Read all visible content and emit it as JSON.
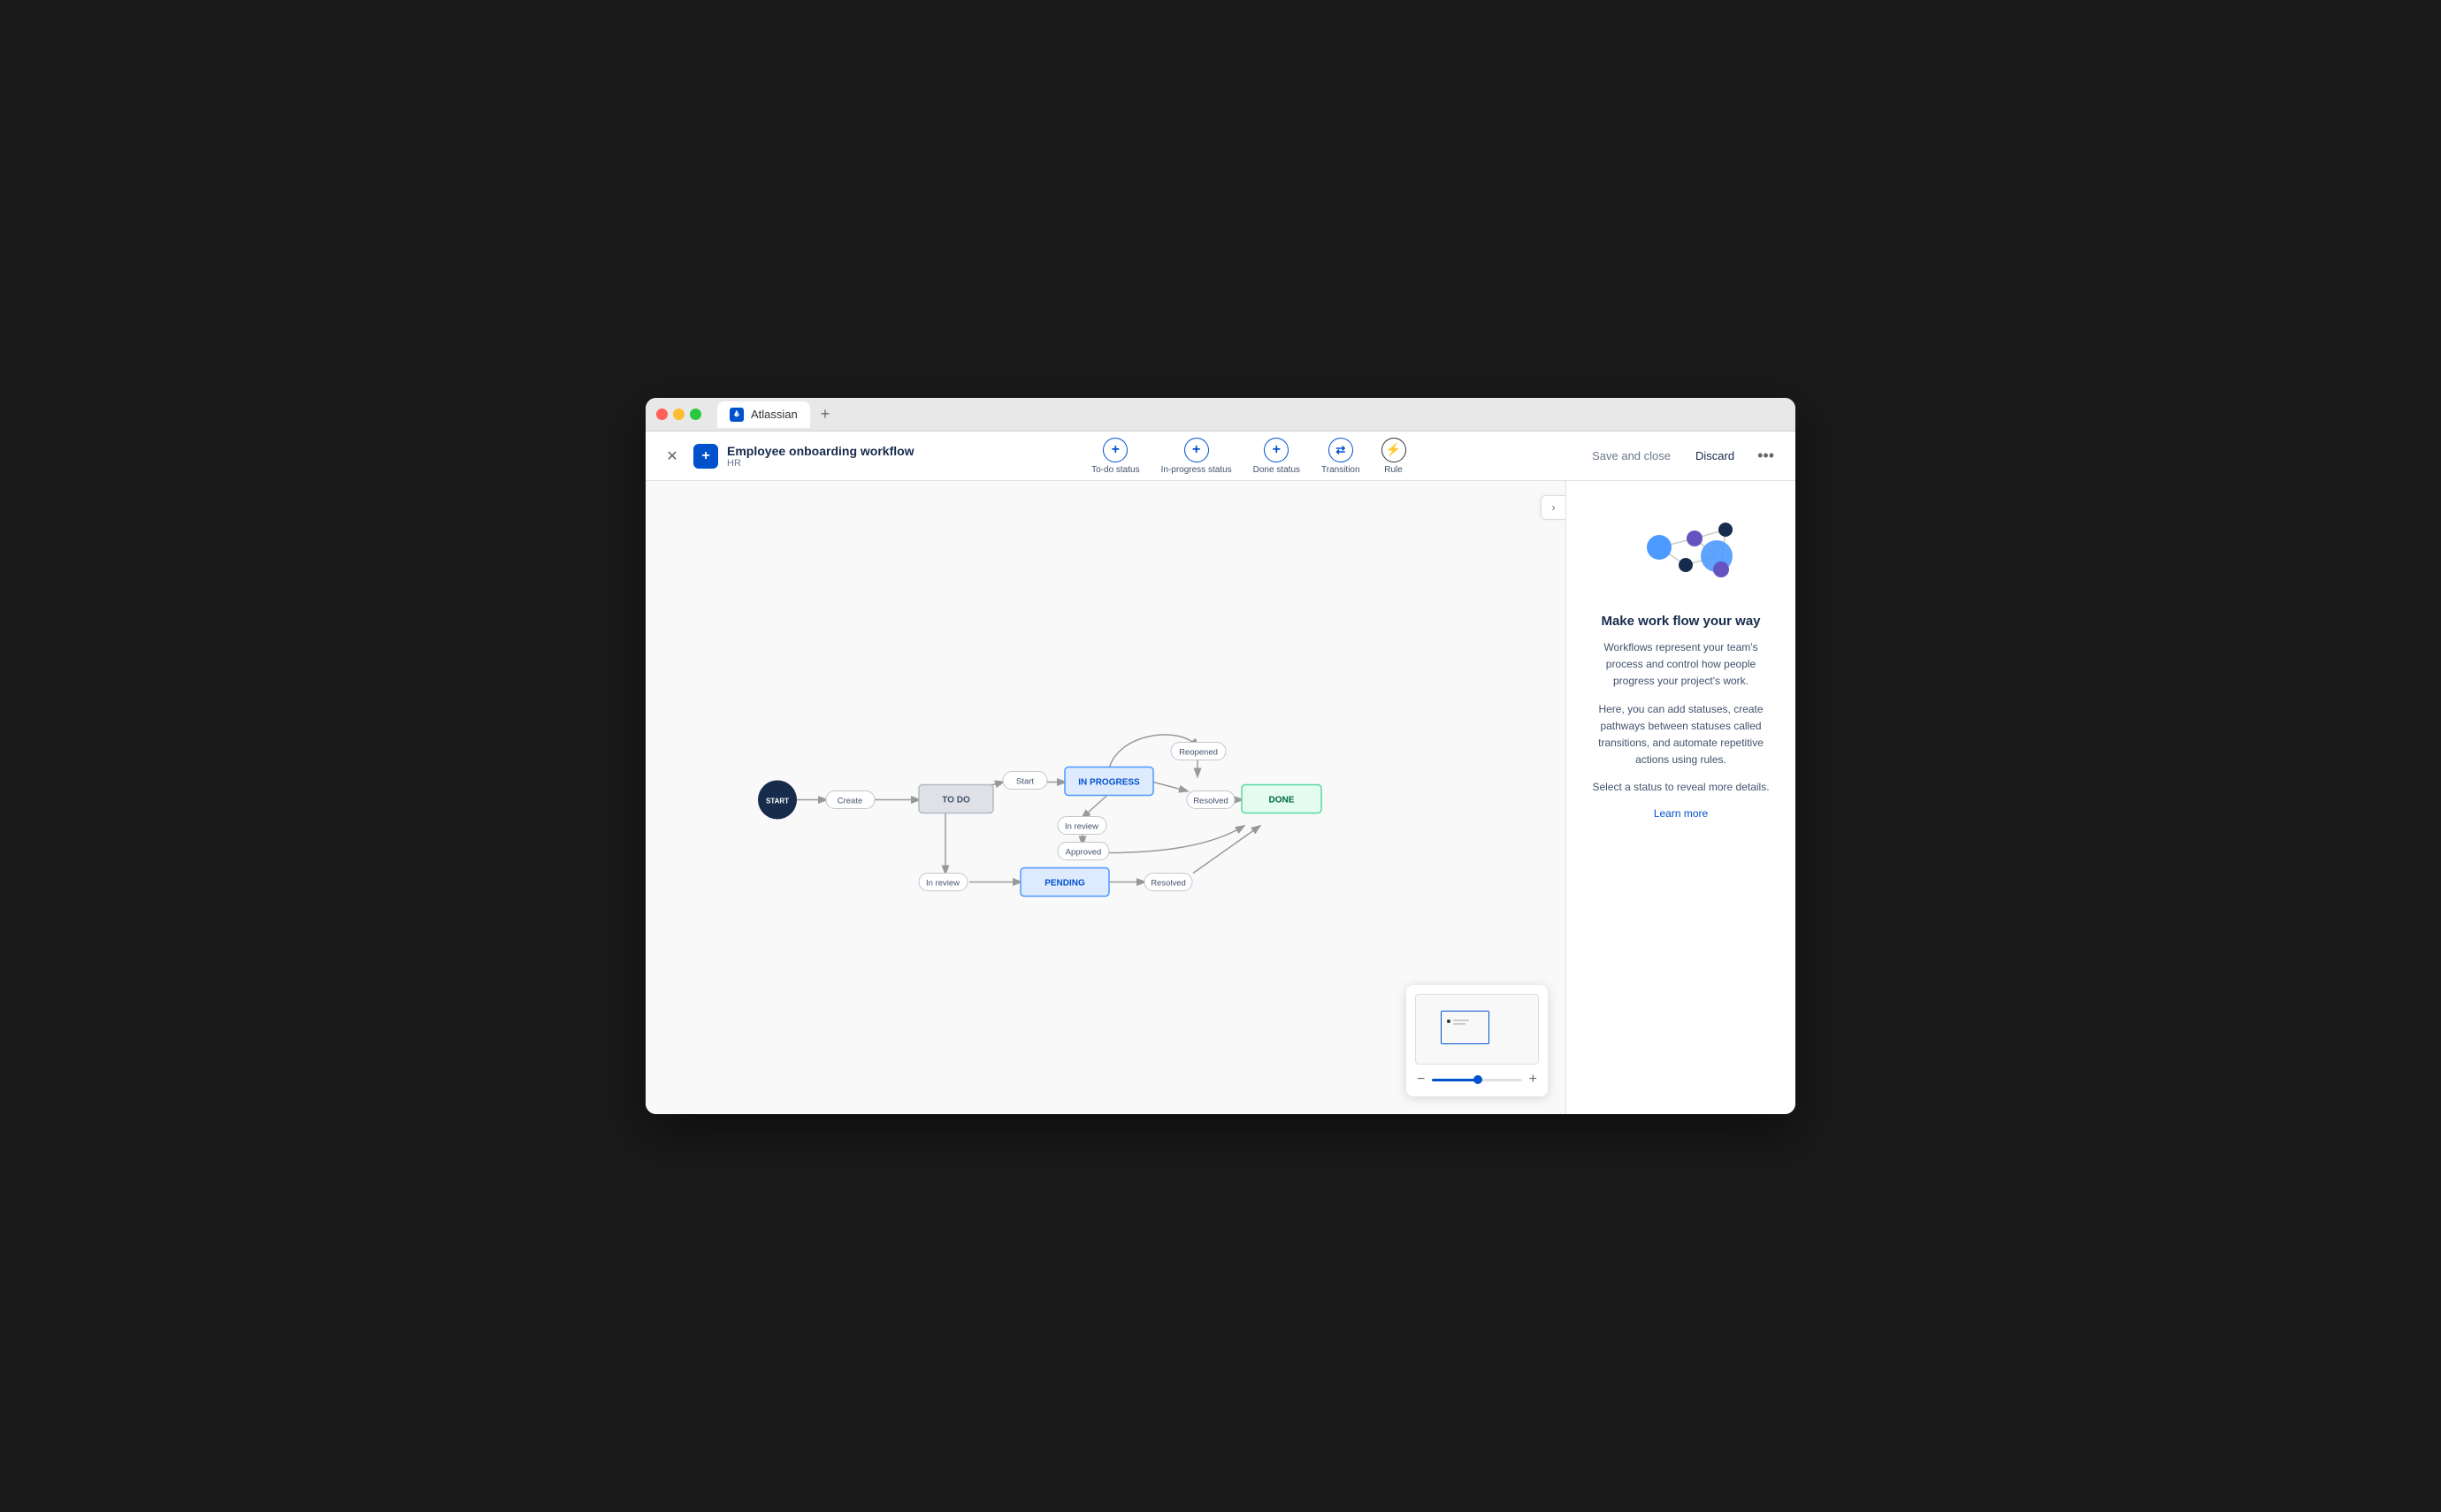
{
  "window": {
    "title": "Atlassian",
    "tab_plus": "+"
  },
  "toolbar": {
    "close_label": "×",
    "add_label": "+",
    "workflow_title": "Employee onboarding workflow",
    "workflow_sub": "HR",
    "actions": [
      {
        "id": "todo-status",
        "label": "To-do status",
        "icon": "+"
      },
      {
        "id": "inprogress-status",
        "label": "In-progress status",
        "icon": "+"
      },
      {
        "id": "done-status",
        "label": "Done status",
        "icon": "+"
      },
      {
        "id": "transition",
        "label": "Transition",
        "icon": "⇄"
      },
      {
        "id": "rule",
        "label": "Rule",
        "icon": "⚡"
      }
    ],
    "save_label": "Save and close",
    "discard_label": "Discard",
    "more_label": "•••"
  },
  "diagram": {
    "nodes": {
      "start": "START",
      "todo": "TO DO",
      "inprogress": "IN PROGRESS",
      "done": "DONE",
      "pending": "PENDING"
    },
    "transitions": {
      "create": "Create",
      "start": "Start",
      "inreview1": "In review",
      "approved": "Approved",
      "inreview2": "In review",
      "resolved1": "Resolved",
      "resolved2": "Resolved",
      "reopened": "Reopened"
    }
  },
  "right_panel": {
    "title": "Make work flow your way",
    "desc1": "Workflows represent your team's process and control how people progress your project's work.",
    "desc2": "Here, you can add statuses, create pathways between statuses called transitions, and automate repetitive actions using rules.",
    "desc3": "Select a status to reveal more details.",
    "link": "Learn more"
  },
  "expand_icon": "›",
  "zoom": {
    "minus": "−",
    "plus": "+"
  }
}
